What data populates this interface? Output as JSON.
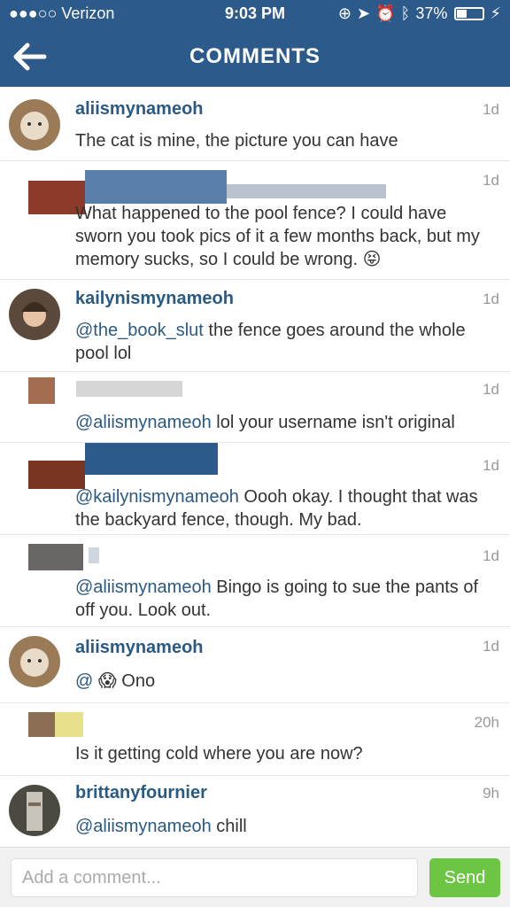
{
  "status_bar": {
    "carrier": "●●●○○ Verizon",
    "time": "9:03 PM",
    "battery_text": "37%",
    "battery_level": 0.37
  },
  "nav": {
    "title": "COMMENTS"
  },
  "comments": [
    {
      "username": "aliismynameoh",
      "time": "1d",
      "text": "The cat is mine, the picture you can have"
    },
    {
      "username": "",
      "time": "1d",
      "text": "What happened to the pool fence? I could have sworn you took pics of it a few months back, but my memory sucks, so I could be wrong. 😝"
    },
    {
      "username": "kailynismynameoh",
      "time": "1d",
      "mention": "@the_book_slut",
      "text": " the fence goes around the whole pool lol"
    },
    {
      "username": "",
      "time": "1d",
      "mention": "@aliismynameoh",
      "text": " lol your username isn't original"
    },
    {
      "username": "",
      "time": "1d",
      "mention": "@kailynismynameoh",
      "text": " Oooh okay. I thought that was the backyard fence, though. My bad."
    },
    {
      "username": "",
      "time": "1d",
      "mention": "@aliismynameoh",
      "text": " Bingo is going to sue the pants of off you. Look out."
    },
    {
      "username": "aliismynameoh",
      "time": "1d",
      "mention": "@",
      "text": "😱 Ono"
    },
    {
      "username": "",
      "time": "20h",
      "text": "Is it getting cold where you are now?"
    },
    {
      "username": "brittanyfournier",
      "time": "9h",
      "mention": "@aliismynameoh",
      "text": " chill"
    }
  ],
  "footer": {
    "placeholder": "Add a comment...",
    "send_label": "Send"
  },
  "colors": {
    "header": "#2c5a8a",
    "link": "#2a5a84",
    "send": "#6cc644"
  }
}
